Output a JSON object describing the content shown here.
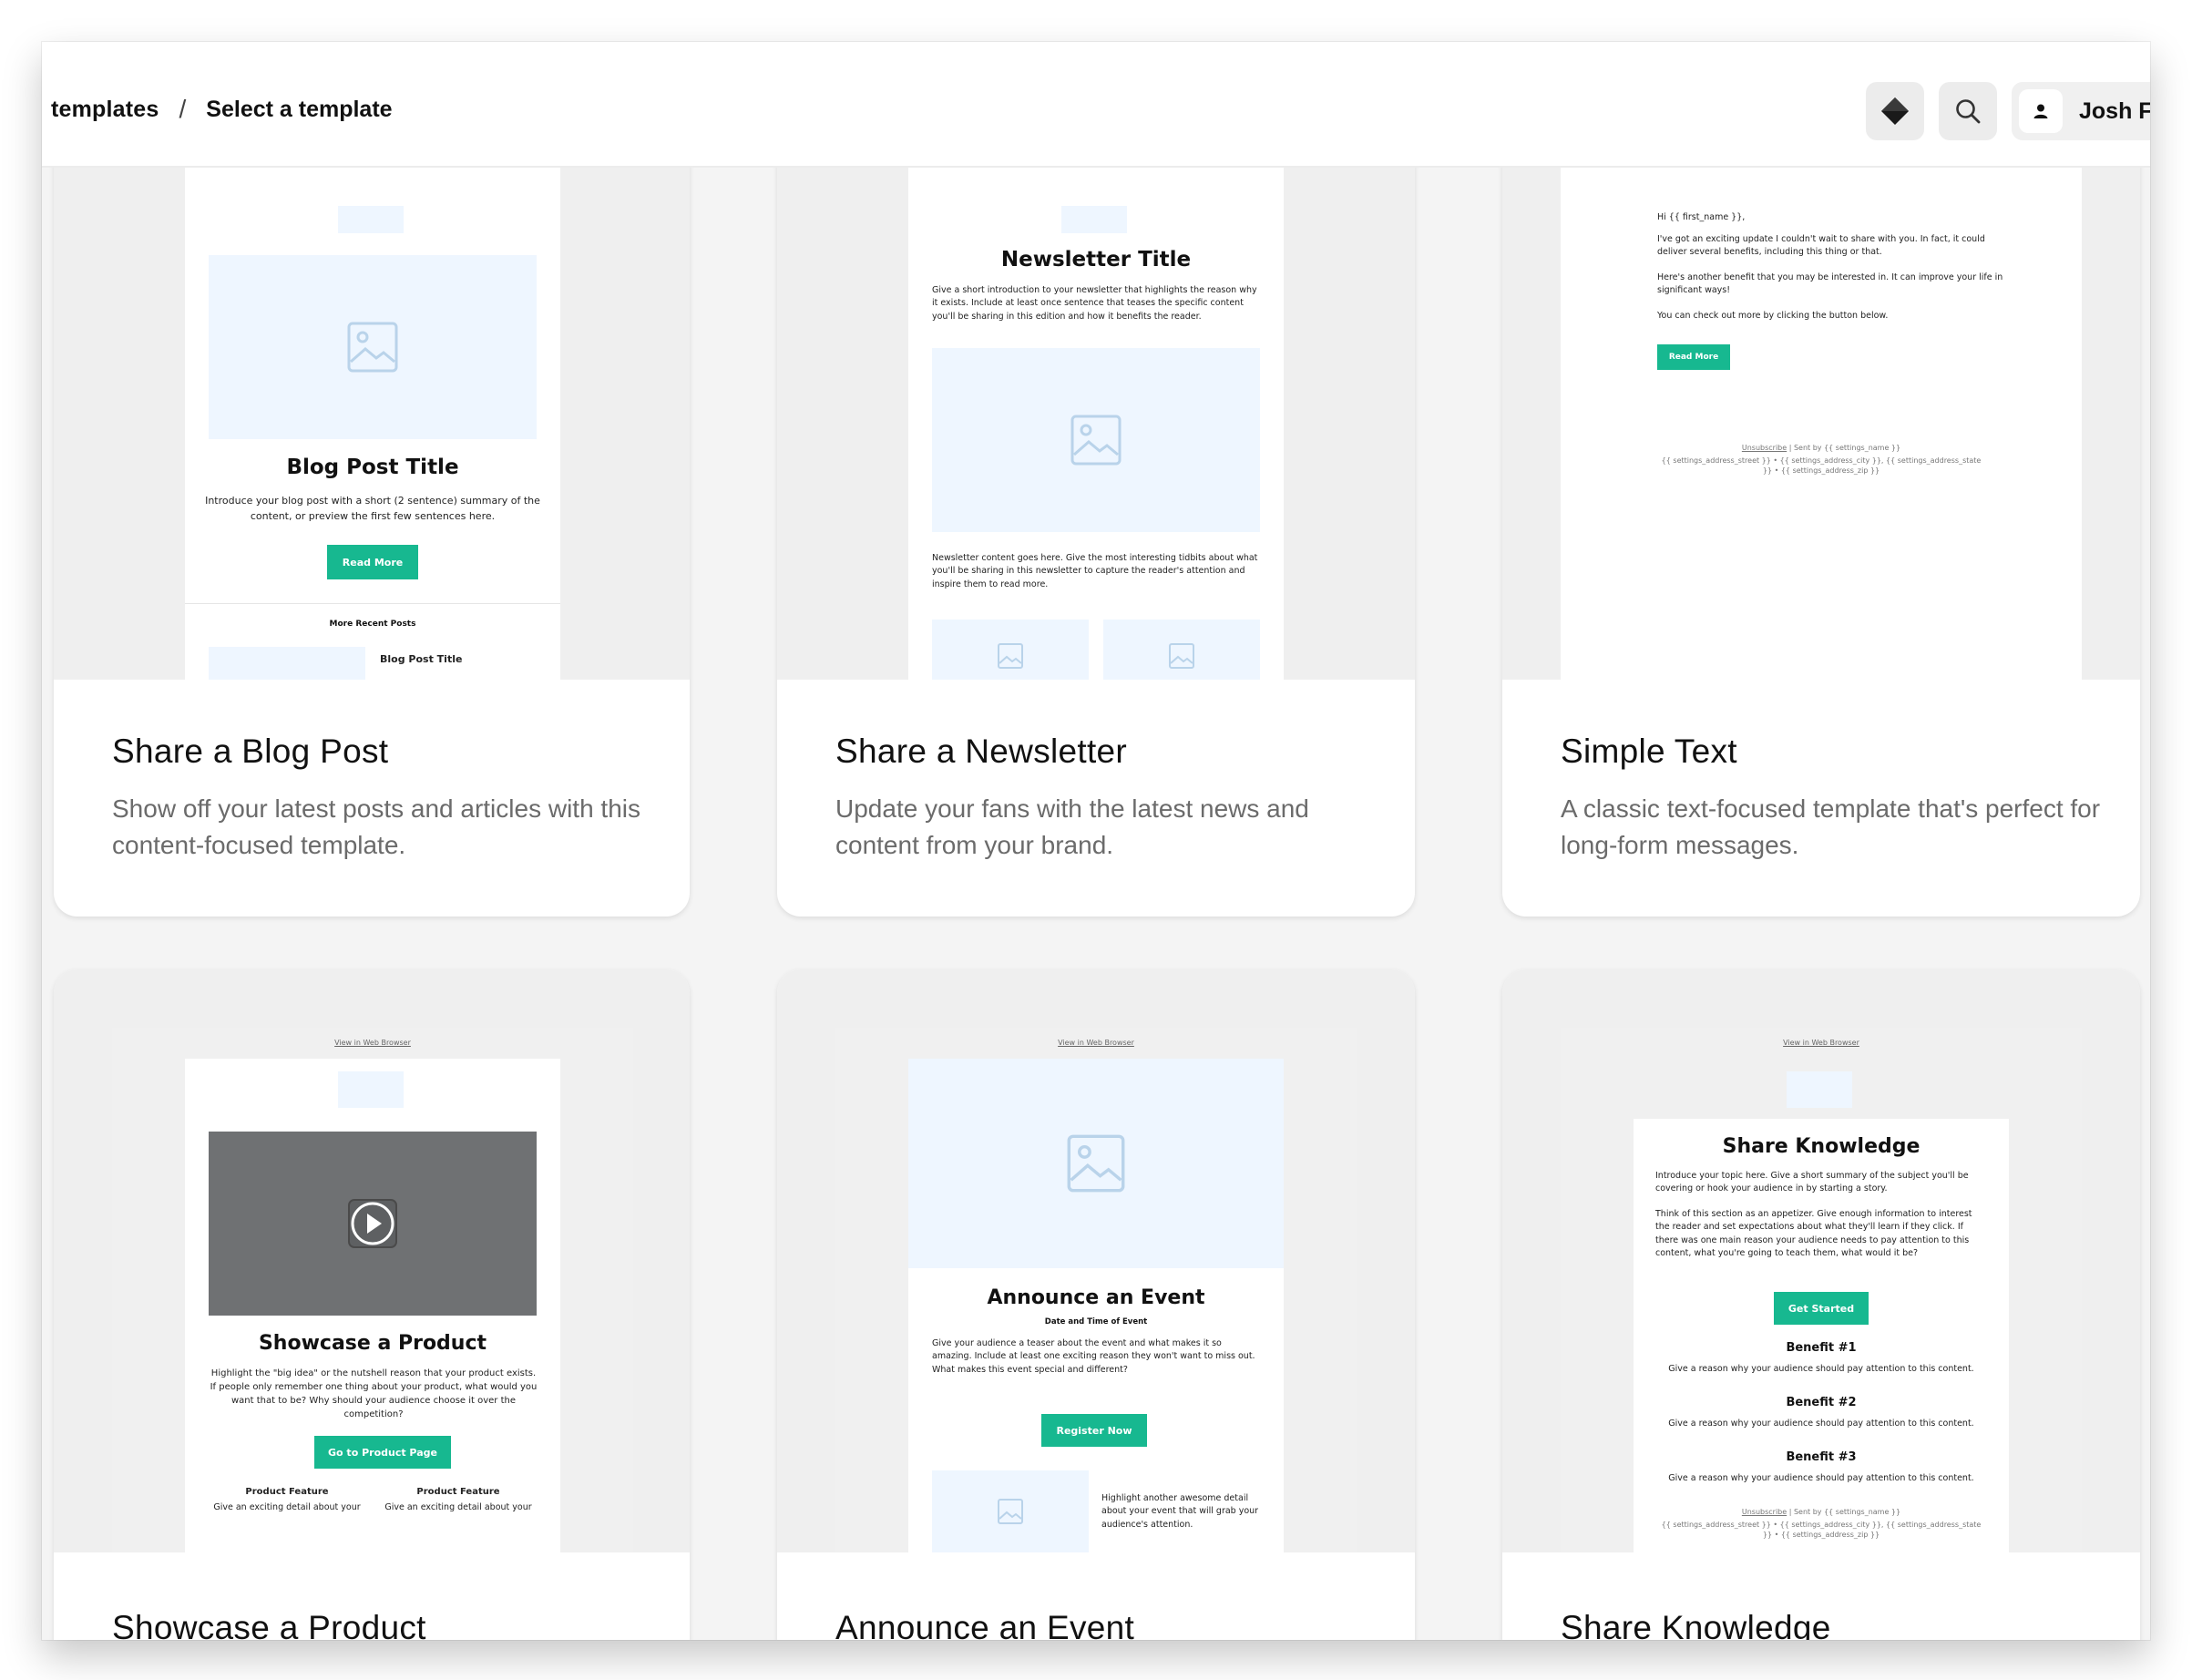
{
  "header": {
    "breadcrumb_parent": "templates",
    "breadcrumb_separator": "/",
    "breadcrumb_current": "Select a template",
    "user_name": "Josh F"
  },
  "icons": {
    "logo": "diamond-logo-icon",
    "search": "search-icon",
    "user": "user-icon"
  },
  "colors": {
    "accent": "#17b890",
    "placeholder": "#eef6ff",
    "preview_bg": "#efefef"
  },
  "templates": [
    {
      "title": "Share a Blog Post",
      "description": "Show off your latest posts and articles with this content-focused template.",
      "preview": {
        "heading": "Blog Post Title",
        "intro": "Introduce your blog post with a short (2 sentence) summary of the content, or preview the first few sentences here.",
        "button": "Read More",
        "section": "More Recent Posts",
        "sub_title": "Blog Post Title"
      }
    },
    {
      "title": "Share a Newsletter",
      "description": "Update your fans with the latest news and content from your brand.",
      "preview": {
        "heading": "Newsletter Title",
        "intro": "Give a short introduction to your newsletter that highlights the reason why it exists. Include at least once sentence that teases the specific content you'll be sharing in this edition and how it benefits the reader.",
        "body": "Newsletter content goes here. Give the most interesting tidbits about what you'll be sharing in this newsletter to capture the reader's attention and inspire them to read more."
      }
    },
    {
      "title": "Simple Text",
      "description": "A classic text-focused template that's perfect for long-form messages.",
      "preview": {
        "greeting": "Hi {{ first_name }},",
        "p1": "I've got an exciting update I couldn't wait to share with you. In fact, it could deliver several benefits, including this thing or that.",
        "p2": "Here's another benefit that you may be interested in. It can improve your life in significant ways!",
        "p3": "You can check out more by clicking the button below.",
        "button": "Read More",
        "footer_link": "Unsubscribe",
        "footer_sent": "| Sent by {{ settings_name }}",
        "footer_address": "{{ settings_address_street }} • {{ settings_address_city }}, {{ settings_address_state }} • {{ settings_address_zip }}"
      }
    },
    {
      "title": "Showcase a Product",
      "description": "",
      "preview": {
        "view_link": "View in Web Browser",
        "heading": "Showcase a Product",
        "intro": "Highlight the \"big idea\" or the nutshell reason that your product exists. If people only remember one thing about your product, what would you want that to be? Why should your audience choose it over the competition?",
        "button": "Go to Product Page",
        "feature_title": "Product Feature",
        "feature_text": "Give an exciting detail about your"
      }
    },
    {
      "title": "Announce an Event",
      "description": "",
      "preview": {
        "view_link": "View in Web Browser",
        "heading": "Announce an Event",
        "subheading": "Date and Time of Event",
        "intro": "Give your audience a teaser about the event and what makes it so amazing. Include at least one exciting reason they won't want to miss out. What makes this event special and different?",
        "button": "Register Now",
        "side_text": "Highlight another awesome detail about your event that will grab your audience's attention."
      }
    },
    {
      "title": "Share Knowledge",
      "description": "",
      "preview": {
        "view_link": "View in Web Browser",
        "heading": "Share Knowledge",
        "p1": "Introduce your topic here. Give a short summary of the subject you'll be covering or hook your audience in by starting a story.",
        "p2": "Think of this section as an appetizer. Give enough information to interest the reader and set expectations about what they'll learn if they click. If there was one main reason your audience needs to pay attention to this content, what you're going to teach them, what would it be?",
        "button": "Get Started",
        "benefits": [
          {
            "title": "Benefit #1",
            "text": "Give a reason why your audience should pay attention to this content."
          },
          {
            "title": "Benefit #2",
            "text": "Give a reason why your audience should pay attention to this content."
          },
          {
            "title": "Benefit #3",
            "text": "Give a reason why your audience should pay attention to this content."
          }
        ],
        "footer_link": "Unsubscribe",
        "footer_sent": "| Sent by {{ settings_name }}",
        "footer_address": "{{ settings_address_street }} • {{ settings_address_city }}, {{ settings_address_state }} • {{ settings_address_zip }}"
      }
    }
  ]
}
